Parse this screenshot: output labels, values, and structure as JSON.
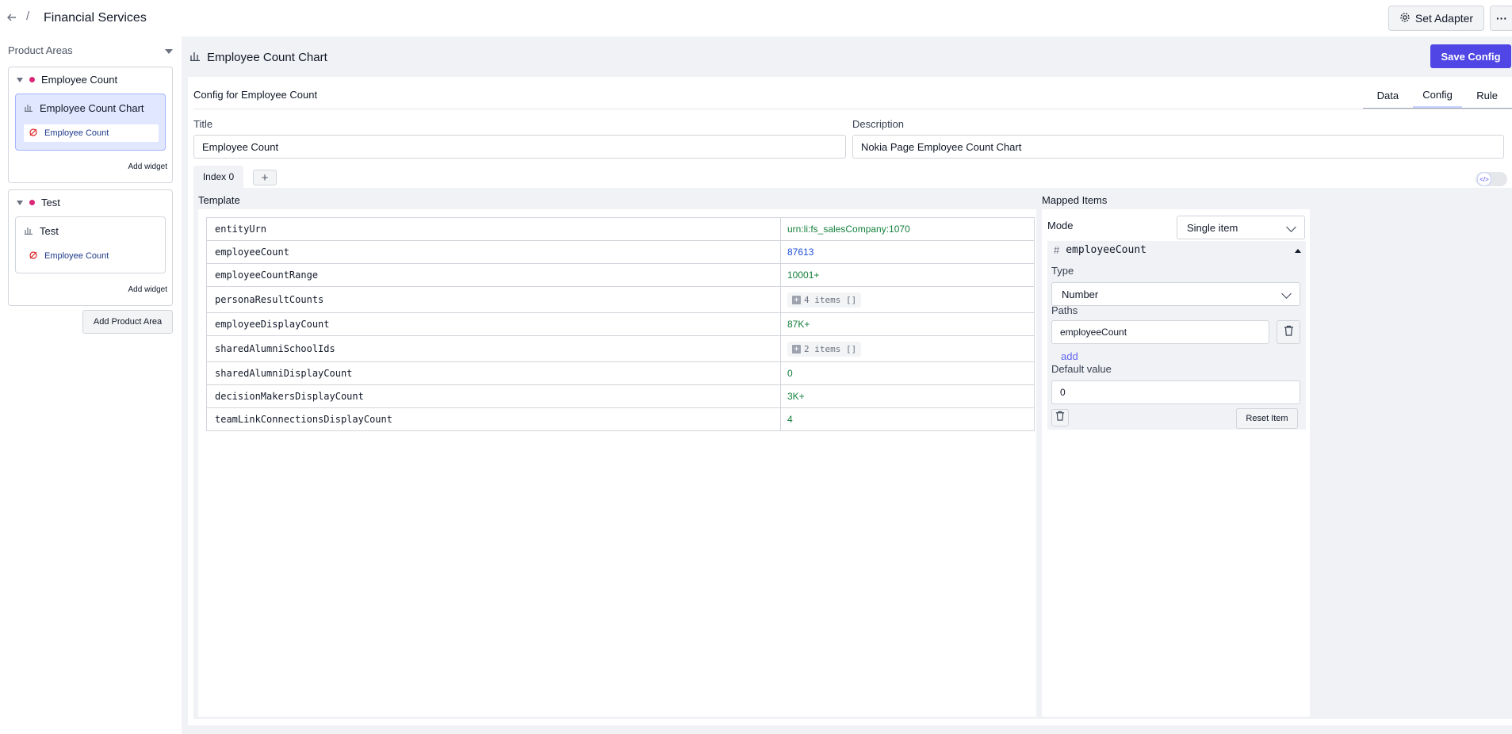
{
  "header": {
    "separator": "/",
    "title": "Financial Services",
    "set_adapter_label": "Set Adapter",
    "more_label": "···"
  },
  "sidebar": {
    "heading": "Product Areas",
    "areas": [
      {
        "name": "Employee Count",
        "widget_title": "Employee Count Chart",
        "widget_item": "Employee Count",
        "add_widget_label": "Add widget"
      },
      {
        "name": "Test",
        "widget_title": "Test",
        "widget_item": "Employee Count",
        "add_widget_label": "Add widget"
      }
    ],
    "add_area_label": "Add Product Area"
  },
  "main": {
    "title": "Employee Count Chart",
    "save_label": "Save Config",
    "config_label": "Config for Employee Count",
    "tabs": [
      "Data",
      "Config",
      "Rule"
    ],
    "active_tab": "Config",
    "title_label": "Title",
    "title_value": "Employee Count",
    "description_label": "Description",
    "description_value": "Nokia Page Employee Count Chart",
    "index_tab": "Index 0",
    "add_index": "+",
    "toggle_icon": "</>"
  },
  "template": {
    "label": "Template",
    "rows": [
      {
        "key": "entityUrn",
        "value": "urn:li:fs_salesCompany:1070"
      },
      {
        "key": "employeeCount",
        "value": "87613"
      },
      {
        "key": "employeeCountRange",
        "value": "10001+"
      },
      {
        "key": "personaResultCounts",
        "value": "4 items  []"
      },
      {
        "key": "employeeDisplayCount",
        "value": "87K+"
      },
      {
        "key": "sharedAlumniSchoolIds",
        "value": "2 items  []"
      },
      {
        "key": "sharedAlumniDisplayCount",
        "value": "0"
      },
      {
        "key": "decisionMakersDisplayCount",
        "value": "3K+"
      },
      {
        "key": "teamLinkConnectionsDisplayCount",
        "value": "4"
      }
    ]
  },
  "mapped": {
    "label": "Mapped Items",
    "mode_label": "Mode",
    "mode_value": "Single item",
    "item_hash": "#",
    "item_name": "employeeCount",
    "type_label": "Type",
    "type_value": "Number",
    "paths_label": "Paths",
    "path_value": "employeeCount",
    "add_label": "add",
    "default_label": "Default value",
    "default_value": "0",
    "reset_label": "Reset Item"
  },
  "colors": {
    "accent": "#4f46e5",
    "string_value": "#15803d",
    "number_value": "#1d4ed8",
    "area_dot": "#db2777"
  }
}
